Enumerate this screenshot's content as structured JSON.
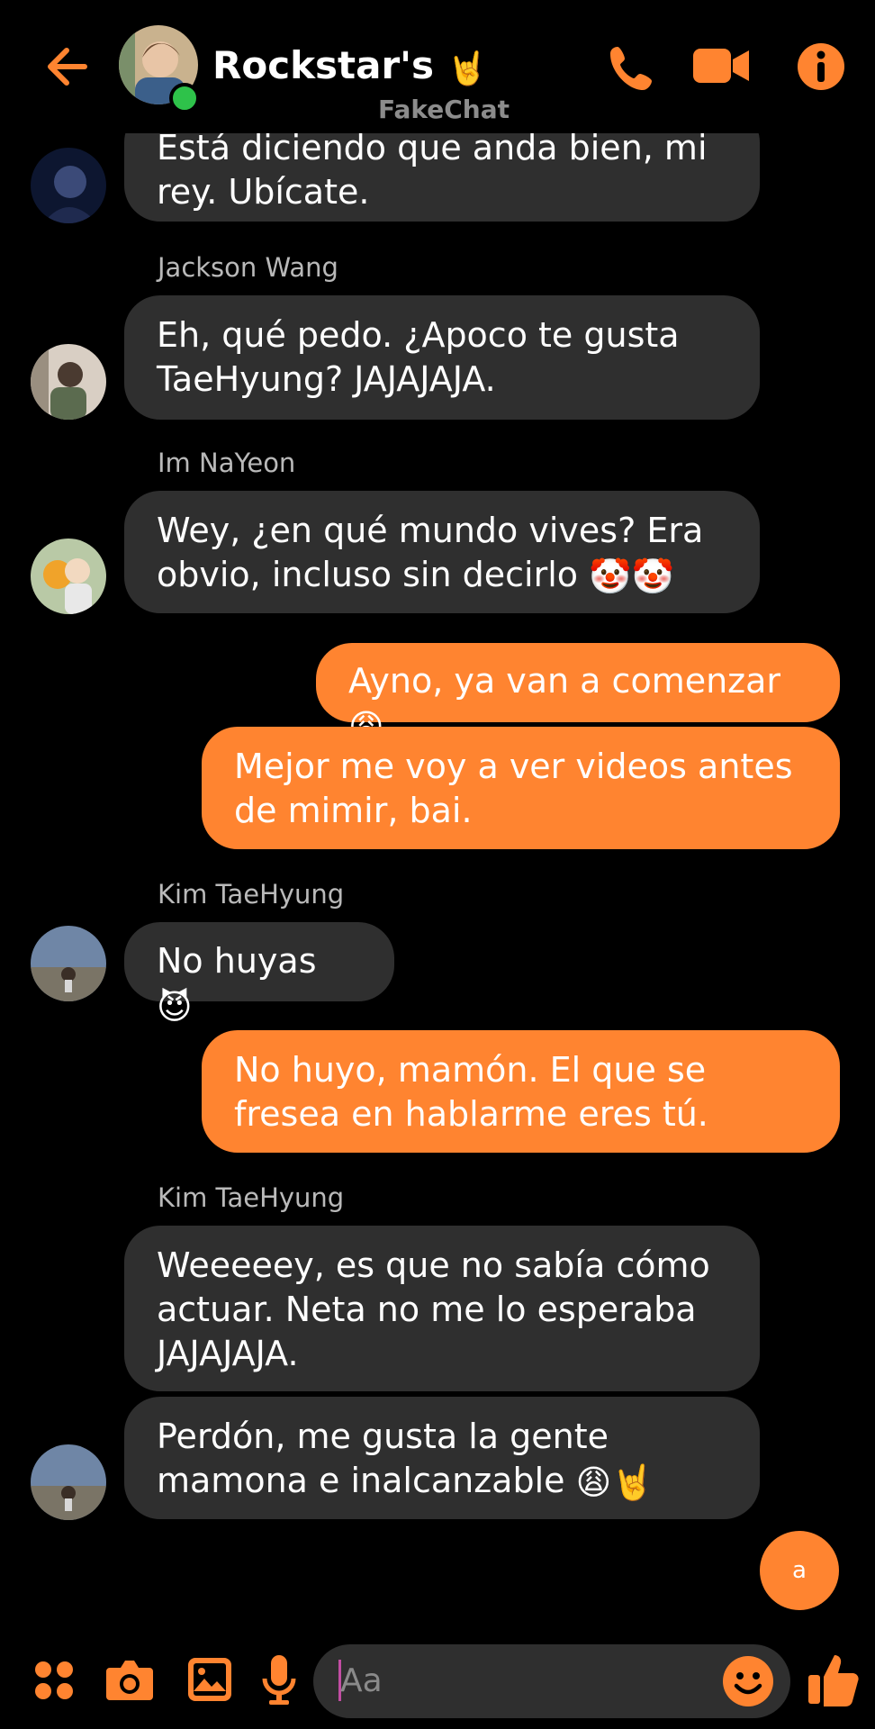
{
  "header": {
    "title": "Rockstar's",
    "title_emoji": "🤘",
    "brand": "FakeChat",
    "icons": [
      "back-arrow-icon",
      "phone-icon",
      "video-camera-icon",
      "info-icon"
    ]
  },
  "colors": {
    "accent": "#ff8430",
    "incoming_bubble": "#2f2f2f",
    "online": "#2ec24a"
  },
  "messages": [
    {
      "sender": "",
      "text": "Está diciendo que anda bien, mi rey. Ubícate.",
      "direction": "in"
    },
    {
      "sender": "Jackson Wang",
      "text": "Eh, qué pedo. ¿Apoco te gusta TaeHyung? JAJAJAJA.",
      "direction": "in"
    },
    {
      "sender": "Im NaYeon",
      "text": "Wey, ¿en qué mundo vives? Era obvio, incluso sin decirlo",
      "emoji": "🤡🤡",
      "direction": "in"
    },
    {
      "sender": "",
      "text": "Ayno, ya van a comenzar",
      "emoji": "😩",
      "direction": "out"
    },
    {
      "sender": "",
      "text": "Mejor me voy a ver videos antes de mimir, bai.",
      "direction": "out"
    },
    {
      "sender": "Kim TaeHyung",
      "text": "No huyas",
      "emoji": "😈",
      "direction": "in"
    },
    {
      "sender": "",
      "text": "No huyo, mamón. El que se fresea en hablarme eres tú.",
      "direction": "out"
    },
    {
      "sender": "Kim TaeHyung",
      "text": "Weeeeey, es que no sabía cómo actuar. Neta no me lo esperaba JAJAJAJA.",
      "direction": "in"
    },
    {
      "sender": "",
      "text": "Perdón, me gusta la gente mamona e inalcanzable",
      "emoji": "😩🤘",
      "direction": "in"
    }
  ],
  "fab_label": "a",
  "composer": {
    "placeholder": "Aa",
    "icons": [
      "apps-icon",
      "camera-icon",
      "gallery-icon",
      "microphone-icon",
      "emoji-icon",
      "thumbs-up-icon"
    ]
  }
}
